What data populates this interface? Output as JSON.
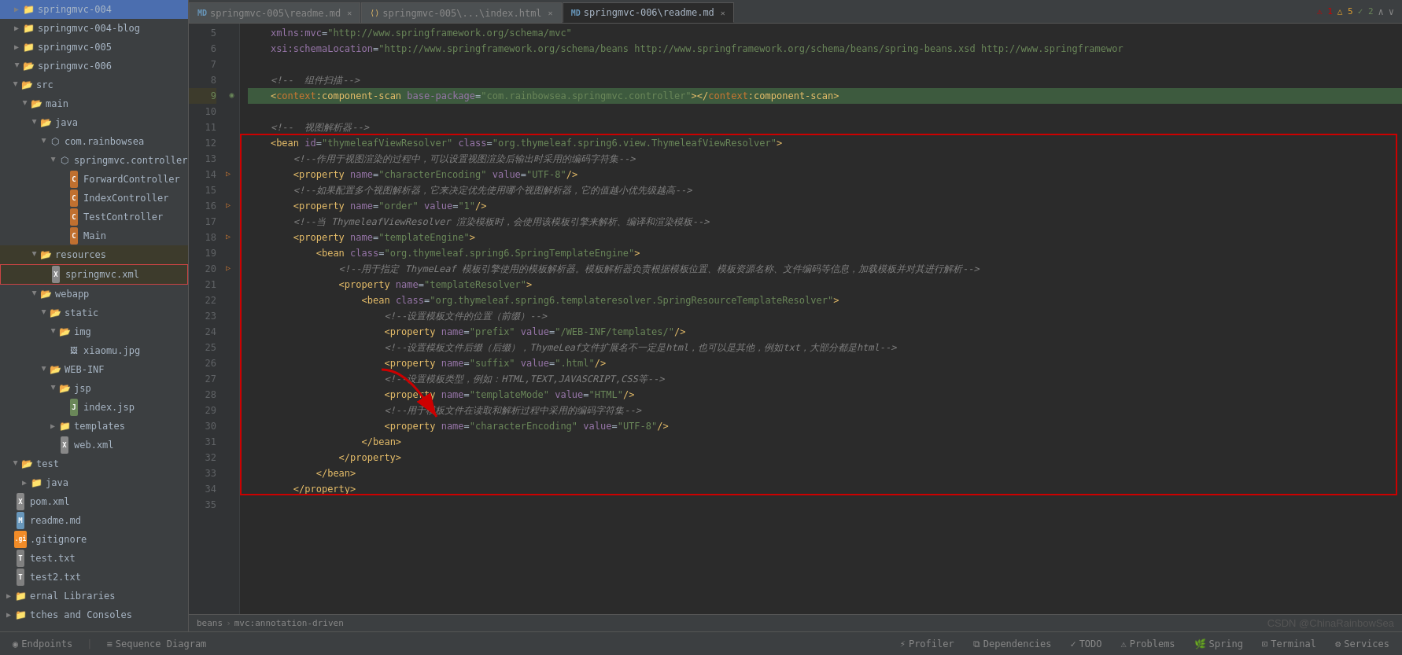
{
  "sidebar": {
    "items": [
      {
        "id": "springmvc-004",
        "label": "springmvc-004",
        "indent": 0,
        "type": "folder",
        "expanded": false
      },
      {
        "id": "springmvc-004-blog",
        "label": "springmvc-004-blog",
        "indent": 0,
        "type": "folder",
        "expanded": false
      },
      {
        "id": "springmvc-005",
        "label": "springmvc-005",
        "indent": 0,
        "type": "folder",
        "expanded": false
      },
      {
        "id": "springmvc-006",
        "label": "springmvc-006",
        "indent": 0,
        "type": "folder",
        "expanded": true
      },
      {
        "id": "src",
        "label": "src",
        "indent": 1,
        "type": "folder",
        "expanded": true
      },
      {
        "id": "main",
        "label": "main",
        "indent": 2,
        "type": "folder",
        "expanded": true
      },
      {
        "id": "java",
        "label": "java",
        "indent": 3,
        "type": "folder-src",
        "expanded": true
      },
      {
        "id": "com.rainbowsea",
        "label": "com.rainbowsea",
        "indent": 4,
        "type": "package",
        "expanded": true
      },
      {
        "id": "springmvc.controller",
        "label": "springmvc.controller",
        "indent": 5,
        "type": "package",
        "expanded": true
      },
      {
        "id": "ForwardController",
        "label": "ForwardController",
        "indent": 6,
        "type": "java"
      },
      {
        "id": "IndexController",
        "label": "IndexController",
        "indent": 6,
        "type": "java"
      },
      {
        "id": "TestController",
        "label": "TestController",
        "indent": 6,
        "type": "java"
      },
      {
        "id": "Main",
        "label": "Main",
        "indent": 6,
        "type": "java"
      },
      {
        "id": "resources",
        "label": "resources",
        "indent": 3,
        "type": "folder",
        "expanded": true,
        "selected": true
      },
      {
        "id": "springmvc.xml",
        "label": "springmvc.xml",
        "indent": 4,
        "type": "xml",
        "selected": true
      },
      {
        "id": "webapp",
        "label": "webapp",
        "indent": 3,
        "type": "folder",
        "expanded": true
      },
      {
        "id": "static",
        "label": "static",
        "indent": 4,
        "type": "folder",
        "expanded": true
      },
      {
        "id": "img",
        "label": "img",
        "indent": 5,
        "type": "folder",
        "expanded": true
      },
      {
        "id": "xiaomu.jpg",
        "label": "xiaomu.jpg",
        "indent": 6,
        "type": "image"
      },
      {
        "id": "WEB-INF",
        "label": "WEB-INF",
        "indent": 4,
        "type": "folder",
        "expanded": true
      },
      {
        "id": "jsp",
        "label": "jsp",
        "indent": 5,
        "type": "folder",
        "expanded": true
      },
      {
        "id": "index.jsp",
        "label": "index.jsp",
        "indent": 6,
        "type": "jsp"
      },
      {
        "id": "templates",
        "label": "templates",
        "indent": 5,
        "type": "folder",
        "expanded": false
      },
      {
        "id": "web.xml",
        "label": "web.xml",
        "indent": 5,
        "type": "xml"
      },
      {
        "id": "test",
        "label": "test",
        "indent": 1,
        "type": "folder",
        "expanded": true
      },
      {
        "id": "test-java",
        "label": "java",
        "indent": 2,
        "type": "folder-src",
        "expanded": false
      },
      {
        "id": "pom.xml",
        "label": "pom.xml",
        "indent": 0,
        "type": "xml"
      },
      {
        "id": "readme.md",
        "label": "readme.md",
        "indent": 0,
        "type": "md"
      },
      {
        "id": ".gitignore",
        "label": ".gitignore",
        "indent": 0,
        "type": "gitignore"
      },
      {
        "id": "test.txt",
        "label": "test.txt",
        "indent": 0,
        "type": "txt"
      },
      {
        "id": "test2.txt",
        "label": "test2.txt",
        "indent": 0,
        "type": "txt"
      },
      {
        "id": "external-libraries",
        "label": "ernal Libraries",
        "indent": 0,
        "type": "folder",
        "expanded": false
      },
      {
        "id": "scratches",
        "label": "tches and Consoles",
        "indent": 0,
        "type": "folder",
        "expanded": false
      }
    ]
  },
  "tabs": [
    {
      "id": "tab1",
      "label": "springmvc-005\\readme.md",
      "icon": "md",
      "active": false,
      "closeable": true
    },
    {
      "id": "tab2",
      "label": "springmvc-005\\...\\index.html",
      "icon": "html",
      "active": false,
      "closeable": true
    },
    {
      "id": "tab3",
      "label": "springmvc-006\\readme.md",
      "icon": "md",
      "active": true,
      "closeable": true
    }
  ],
  "indicators": {
    "errors": "1",
    "warnings": "5",
    "ok": "2"
  },
  "code_lines": [
    {
      "num": 5,
      "content": "    xmlns:mvc=\"http://www.springframework.org/schema/mvc\"",
      "type": "attr-line"
    },
    {
      "num": 6,
      "content": "    xsi:schemaLocation=\"http://www.springframework.org/schema/beans http://www.springframework.org/schema/beans/spring-beans.xsd http://www.springframewor",
      "type": "attr-line"
    },
    {
      "num": 7,
      "content": "",
      "type": "empty"
    },
    {
      "num": 8,
      "content": "    <!--  组件扫描-->",
      "type": "comment"
    },
    {
      "num": 9,
      "content": "    <context:component-scan base-package=\"com.rainbowsea.springmvc.controller\"></context:component-scan>",
      "type": "tag-highlighted"
    },
    {
      "num": 10,
      "content": "",
      "type": "empty"
    },
    {
      "num": 11,
      "content": "    <!--  视图解析器-->",
      "type": "comment"
    },
    {
      "num": 12,
      "content": "    <bean id=\"thymeleafViewResolver\" class=\"org.thymeleaf.spring6.view.ThymeleafViewResolver\">",
      "type": "tag-red"
    },
    {
      "num": 13,
      "content": "        <!--作用于视图渲染的过程中，可以设置视图渲染后输出时采用的编码字符集-->",
      "type": "comment-red"
    },
    {
      "num": 14,
      "content": "        <property name=\"characterEncoding\" value=\"UTF-8\"/>",
      "type": "tag-red"
    },
    {
      "num": 15,
      "content": "        <!--如果配置多个视图解析器，它来决定优先使用哪个视图解析器，它的值越小优先级越高-->",
      "type": "comment-red"
    },
    {
      "num": 16,
      "content": "        <property name=\"order\" value=\"1\"/>",
      "type": "tag-red"
    },
    {
      "num": 17,
      "content": "        <!--当 ThymeleafViewResolver 渲染模板时，会使用该模板引擎来解析、编译和渲染模板-->",
      "type": "comment-red"
    },
    {
      "num": 18,
      "content": "        <property name=\"templateEngine\">",
      "type": "tag-red"
    },
    {
      "num": 19,
      "content": "            <bean class=\"org.thymeleaf.spring6.SpringTemplateEngine\">",
      "type": "tag-red"
    },
    {
      "num": 20,
      "content": "                <!--用于指定 ThymeLeaf 模板引擎使用的模板解析器。模板解析器负责根据模板位置、模板资源名称、文件编码等信息，加载模板并对其进行解析-->",
      "type": "comment-red"
    },
    {
      "num": 21,
      "content": "                <property name=\"templateResolver\">",
      "type": "tag-red"
    },
    {
      "num": 22,
      "content": "                    <bean class=\"org.thymeleaf.spring6.templateresolver.SpringResourceTemplateResolver\">",
      "type": "tag-red"
    },
    {
      "num": 23,
      "content": "                        <!--设置模板文件的位置（前缀）-->",
      "type": "comment-red"
    },
    {
      "num": 24,
      "content": "                        <property name=\"prefix\" value=\"/WEB-INF/templates/\"/>",
      "type": "tag-red"
    },
    {
      "num": 25,
      "content": "                        <!--设置模板文件后缀（后缀），ThymeLeaf文件扩展名不一定是html，也可以是其他，例如txt，大部分都是html-->",
      "type": "comment-red"
    },
    {
      "num": 26,
      "content": "                        <property name=\"suffix\" value=\".html\"/>",
      "type": "tag-red"
    },
    {
      "num": 27,
      "content": "                        <!--设置模板类型，例如：HTML,TEXT,JAVASCRIPT,CSS等-->",
      "type": "comment-red"
    },
    {
      "num": 28,
      "content": "                        <property name=\"templateMode\" value=\"HTML\"/>",
      "type": "tag-red"
    },
    {
      "num": 29,
      "content": "                        <!--用于模板文件在读取和解析过程中采用的编码字符集-->",
      "type": "comment-red"
    },
    {
      "num": 30,
      "content": "                        <property name=\"characterEncoding\" value=\"UTF-8\"/>",
      "type": "tag-red"
    },
    {
      "num": 31,
      "content": "                    </bean>",
      "type": "tag-red"
    },
    {
      "num": 32,
      "content": "                </property>",
      "type": "tag-red"
    },
    {
      "num": 33,
      "content": "            </bean>",
      "type": "tag-red"
    },
    {
      "num": 34,
      "content": "        </property>",
      "type": "tag-red"
    },
    {
      "num": 35,
      "content": "",
      "type": "empty"
    }
  ],
  "breadcrumb": {
    "root": "beans",
    "path": "mvc:annotation-driven"
  },
  "bottom_tabs": [
    {
      "label": "Profiler",
      "icon": "⚡"
    },
    {
      "label": "Dependencies",
      "icon": "📦"
    },
    {
      "label": "TODO",
      "icon": "✓"
    },
    {
      "label": "Problems",
      "icon": "⚠"
    },
    {
      "label": "Spring",
      "icon": "🌿"
    },
    {
      "label": "Terminal",
      "icon": ">_"
    },
    {
      "label": "Services",
      "icon": "⚙"
    }
  ],
  "bottom_left_tabs": [
    {
      "label": "Endpoints",
      "icon": "◉"
    },
    {
      "label": "Sequence Diagram",
      "icon": "≡"
    }
  ],
  "watermark": "CSDN @ChinaRainbowSea"
}
